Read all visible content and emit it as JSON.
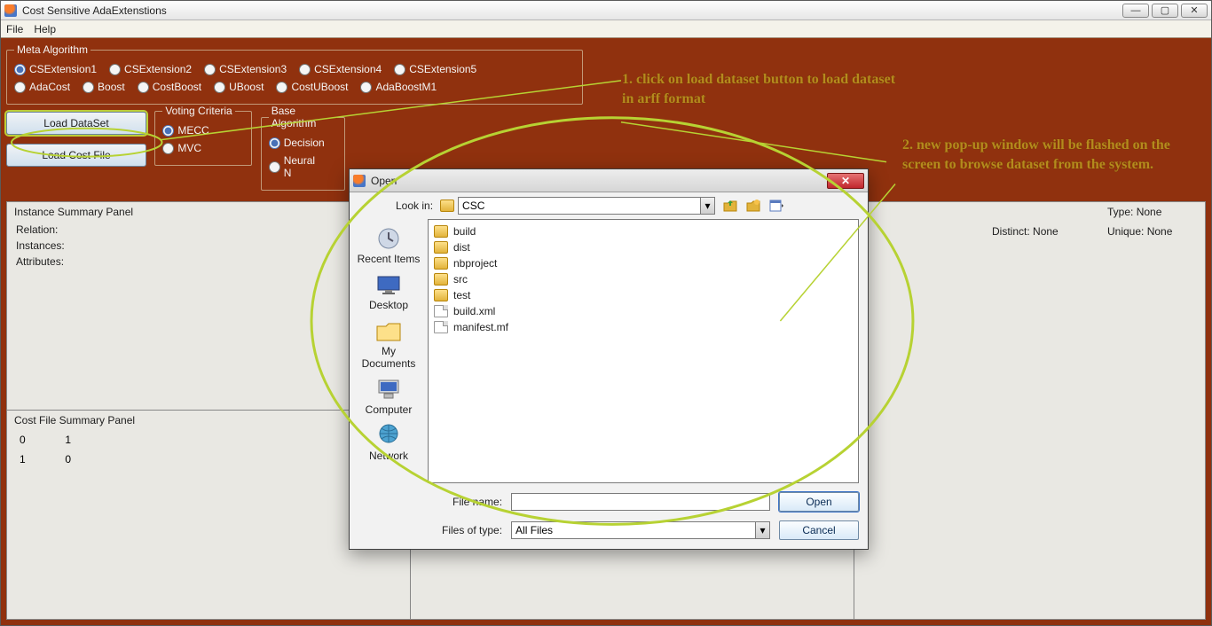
{
  "window": {
    "title": "Cost Sensitive AdaExtenstions",
    "menubar": [
      "File",
      "Help"
    ]
  },
  "meta_algorithm": {
    "legend": "Meta Algorithm",
    "row1": [
      {
        "label": "CSExtension1",
        "checked": true
      },
      {
        "label": "CSExtension2",
        "checked": false
      },
      {
        "label": "CSExtension3",
        "checked": false
      },
      {
        "label": "CSExtension4",
        "checked": false
      },
      {
        "label": "CSExtension5",
        "checked": false
      }
    ],
    "row2": [
      {
        "label": "AdaCost",
        "checked": false
      },
      {
        "label": "Boost",
        "checked": false
      },
      {
        "label": "CostBoost",
        "checked": false
      },
      {
        "label": "UBoost",
        "checked": false
      },
      {
        "label": "CostUBoost",
        "checked": false
      },
      {
        "label": "AdaBoostM1",
        "checked": false
      }
    ]
  },
  "buttons": {
    "load_dataset": "Load DataSet",
    "load_costfile": "Load Cost File"
  },
  "voting": {
    "legend": "Voting Criteria",
    "options": [
      {
        "label": "MECC",
        "checked": true
      },
      {
        "label": "MVC",
        "checked": false
      }
    ]
  },
  "base": {
    "legend": "Base Algorithm",
    "options": [
      {
        "label": "Decision",
        "checked": true
      },
      {
        "label": "Neural N",
        "checked": false
      }
    ]
  },
  "panels": {
    "instance": {
      "title": "Instance Summary Panel",
      "relation_label": "Relation:",
      "instances_label": "Instances:",
      "attributes_label": "Attributes:"
    },
    "costfile": {
      "title": "Cost File Summary Panel",
      "matrix": [
        [
          0,
          1
        ],
        [
          1,
          0
        ]
      ]
    },
    "attribute": {
      "type_label": "Type:",
      "distinct_label": "Distinct:",
      "unique_label": "Unique:",
      "none": "None"
    }
  },
  "annotations": {
    "step1": "1. click on load dataset button to load dataset in arff format",
    "step2": "2. new pop-up window will be flashed on the screen to browse dataset from the system."
  },
  "dialog": {
    "title": "Open",
    "lookin_label": "Look in:",
    "lookin_value": "CSC",
    "filename_label": "File name:",
    "filename_value": "",
    "filetype_label": "Files of type:",
    "filetype_value": "All Files",
    "open_btn": "Open",
    "cancel_btn": "Cancel",
    "places": [
      "Recent Items",
      "Desktop",
      "My Documents",
      "Computer",
      "Network"
    ],
    "files": [
      {
        "name": "build",
        "kind": "folder"
      },
      {
        "name": "dist",
        "kind": "folder"
      },
      {
        "name": "nbproject",
        "kind": "folder"
      },
      {
        "name": "src",
        "kind": "folder"
      },
      {
        "name": "test",
        "kind": "folder"
      },
      {
        "name": "build.xml",
        "kind": "file"
      },
      {
        "name": "manifest.mf",
        "kind": "file"
      }
    ]
  }
}
